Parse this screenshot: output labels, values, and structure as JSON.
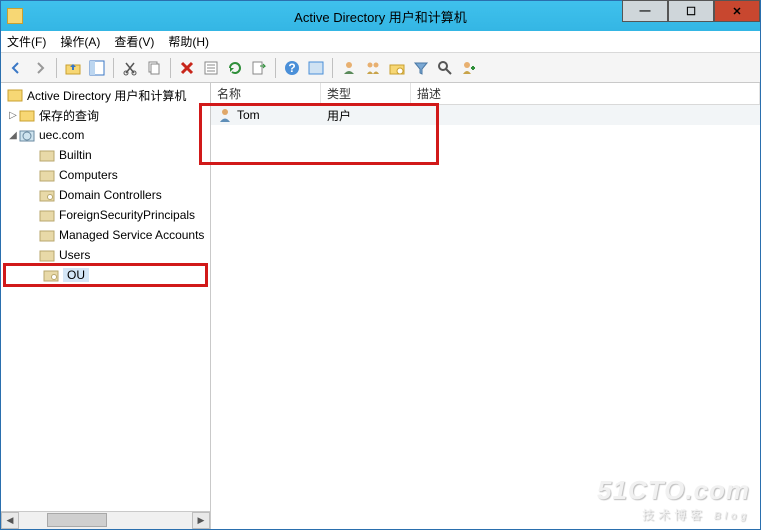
{
  "titlebar": {
    "title": "Active Directory 用户和计算机"
  },
  "menu": {
    "file": "文件(F)",
    "action": "操作(A)",
    "view": "查看(V)",
    "help": "帮助(H)"
  },
  "tree": {
    "root": "Active Directory 用户和计算机",
    "saved_queries": "保存的查询",
    "domain": "uec.com",
    "children": [
      "Builtin",
      "Computers",
      "Domain Controllers",
      "ForeignSecurityPrincipals",
      "Managed Service Accounts",
      "Users",
      "OU"
    ]
  },
  "list": {
    "columns": {
      "name": "名称",
      "type": "类型",
      "desc": "描述"
    },
    "rows": [
      {
        "name": "Tom",
        "type": "用户",
        "desc": ""
      }
    ]
  },
  "watermark": {
    "line1": "51CTO.com",
    "line2": "技术博客",
    "blog": "Blog"
  }
}
